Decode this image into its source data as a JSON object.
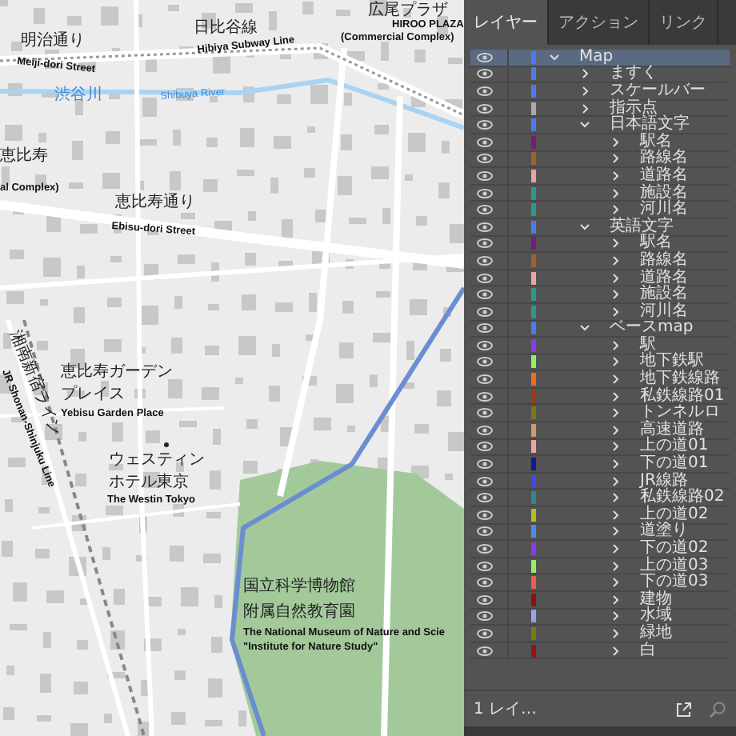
{
  "map": {
    "labels": [
      {
        "text": "明治通り",
        "kind": "ja"
      },
      {
        "text": "日比谷線",
        "kind": "ja"
      },
      {
        "text": "広尾プラザ",
        "kind": "ja"
      },
      {
        "text": "HIROO PLAZA",
        "kind": "en"
      },
      {
        "text": "(Commercial Complex)",
        "kind": "en"
      },
      {
        "text": "Meiji-dori Street",
        "kind": "en"
      },
      {
        "text": "Hibiya Subway Line",
        "kind": "en"
      },
      {
        "text": "渋谷川",
        "kind": "water"
      },
      {
        "text": "Shibuya River",
        "kind": "water"
      },
      {
        "text": "恵比寿",
        "kind": "ja"
      },
      {
        "text": "al Complex)",
        "kind": "en"
      },
      {
        "text": "恵比寿通り",
        "kind": "ja"
      },
      {
        "text": "Ebisu-dori Street",
        "kind": "en"
      },
      {
        "text": "湘南新宿ライン",
        "kind": "ja"
      },
      {
        "text": "JR Shonan-Shinjuku Line",
        "kind": "en"
      },
      {
        "text": "恵比寿ガーデン",
        "kind": "ja"
      },
      {
        "text": "プレイス",
        "kind": "ja"
      },
      {
        "text": "Yebisu Garden Place",
        "kind": "en"
      },
      {
        "text": "ウェスティン",
        "kind": "ja"
      },
      {
        "text": "ホテル東京",
        "kind": "ja"
      },
      {
        "text": "The Westin Tokyo",
        "kind": "en"
      },
      {
        "text": "国立科学博物館",
        "kind": "ja"
      },
      {
        "text": "附属自然教育園",
        "kind": "ja"
      },
      {
        "text": "The National Museum of Nature and Scie",
        "kind": "en"
      },
      {
        "text": "\"Institute for Nature Study\"",
        "kind": "en"
      }
    ]
  },
  "tabs": [
    {
      "label": "レイヤー",
      "selected": true
    },
    {
      "label": "アクション",
      "selected": false
    },
    {
      "label": "リンク",
      "selected": false
    }
  ],
  "layers": [
    {
      "label": "Map",
      "color": "#4a7bf0",
      "selected": true,
      "expanded": true,
      "children": [
        {
          "label": "ますく",
          "color": "#4a7bf0",
          "selected": false,
          "expanded": false
        },
        {
          "label": "スケールバー",
          "color": "#4a7bf0",
          "selected": false,
          "expanded": false
        },
        {
          "label": "指示点",
          "color": "#aaaaaa",
          "selected": false,
          "expanded": false
        },
        {
          "label": "日本語文字",
          "color": "#4a7bf0",
          "selected": false,
          "expanded": true,
          "children": [
            {
              "label": "駅名",
              "color": "#7a1a7a",
              "selected": false,
              "expanded": false
            },
            {
              "label": "路線名",
              "color": "#a0622a",
              "selected": false,
              "expanded": false
            },
            {
              "label": "道路名",
              "color": "#f0a0a0",
              "selected": false,
              "expanded": false
            },
            {
              "label": "施設名",
              "color": "#2a9a8a",
              "selected": false,
              "expanded": false
            },
            {
              "label": "河川名",
              "color": "#2a9a8a",
              "selected": false,
              "expanded": false
            }
          ]
        },
        {
          "label": "英語文字",
          "color": "#4a7bf0",
          "selected": false,
          "expanded": true,
          "children": [
            {
              "label": "駅名",
              "color": "#7a1a7a",
              "selected": false,
              "expanded": false
            },
            {
              "label": "路線名",
              "color": "#a0622a",
              "selected": false,
              "expanded": false
            },
            {
              "label": "道路名",
              "color": "#f0a0a0",
              "selected": false,
              "expanded": false
            },
            {
              "label": "施設名",
              "color": "#2a9a8a",
              "selected": false,
              "expanded": false
            },
            {
              "label": "河川名",
              "color": "#2a9a8a",
              "selected": false,
              "expanded": false
            }
          ]
        },
        {
          "label": "ベースmap",
          "color": "#4a7bf0",
          "selected": false,
          "expanded": true,
          "children": [
            {
              "label": "駅",
              "color": "#8a3af0",
              "selected": false,
              "expanded": false
            },
            {
              "label": "地下鉄駅",
              "color": "#90f060",
              "selected": false,
              "expanded": false
            },
            {
              "label": "地下鉄線路",
              "color": "#f06a20",
              "selected": false,
              "expanded": false
            },
            {
              "label": "私鉄線路01",
              "color": "#a03a10",
              "selected": false,
              "expanded": false
            },
            {
              "label": "トンネルロ",
              "color": "#7a7a10",
              "selected": false,
              "expanded": false
            },
            {
              "label": "高速道路",
              "color": "#d09a70",
              "selected": false,
              "expanded": false
            },
            {
              "label": "上の道01",
              "color": "#f0a0a0",
              "selected": false,
              "expanded": false
            },
            {
              "label": "下の道01",
              "color": "#101a90",
              "selected": false,
              "expanded": false
            },
            {
              "label": "JR線路",
              "color": "#3a4af0",
              "selected": false,
              "expanded": false
            },
            {
              "label": "私鉄線路02",
              "color": "#2a8a8a",
              "selected": false,
              "expanded": false
            },
            {
              "label": "上の道02",
              "color": "#b0c020",
              "selected": false,
              "expanded": false
            },
            {
              "label": "道塗り",
              "color": "#4a8af0",
              "selected": false,
              "expanded": false
            },
            {
              "label": "下の道02",
              "color": "#8a3af0",
              "selected": false,
              "expanded": false
            },
            {
              "label": "上の道03",
              "color": "#90f060",
              "selected": false,
              "expanded": false
            },
            {
              "label": "下の道03",
              "color": "#f05a50",
              "selected": false,
              "expanded": false
            },
            {
              "label": "建物",
              "color": "#901010",
              "selected": false,
              "expanded": false
            },
            {
              "label": "水域",
              "color": "#9aa0f0",
              "selected": false,
              "expanded": false
            },
            {
              "label": "緑地",
              "color": "#7a7a10",
              "selected": false,
              "expanded": false
            },
            {
              "label": "白",
              "color": "#a01010",
              "selected": false,
              "expanded": false
            }
          ]
        }
      ]
    }
  ],
  "footer": {
    "count": "1 レイ…"
  }
}
